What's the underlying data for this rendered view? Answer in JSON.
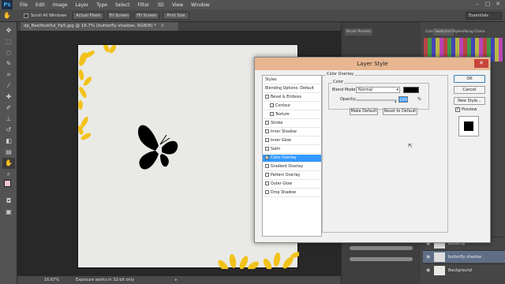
{
  "app": {
    "logo": "Ps"
  },
  "menu": [
    "File",
    "Edit",
    "Image",
    "Layer",
    "Type",
    "Select",
    "Filter",
    "3D",
    "View",
    "Window"
  ],
  "window_controls": {
    "minimize": "–",
    "maximize": "□",
    "close": "✕"
  },
  "options_bar": {
    "scroll_all_label": "Scroll All Windows",
    "actual_pixels": "Actual Pixels",
    "fit_screen": "Fit Screen",
    "fill_screen": "Fill Screen",
    "print_size": "Print Size",
    "workspace": "Essentials"
  },
  "document": {
    "tab_title": "dp_BeeYoutiful_Pp5.jpg @ 16.7% (butterfly shadow, RGB/8) *"
  },
  "status": {
    "zoom": "16.67%",
    "message": "Exposure works in 32-bit only"
  },
  "panels": {
    "brush_presets": "Brush Presets",
    "tabs": [
      "Color",
      "Swatches",
      "Styles",
      "Parag",
      "Chara"
    ]
  },
  "layers": [
    {
      "name": "butterfly",
      "italic": false
    },
    {
      "name": "butterfly shadow",
      "italic": false,
      "selected": true
    },
    {
      "name": "Background",
      "italic": true
    }
  ],
  "dialog": {
    "title": "Layer Style",
    "close": "✕",
    "styles_header": "Styles",
    "blending_options": "Blending Options: Default",
    "effects": [
      {
        "label": "Bevel & Emboss",
        "checked": false,
        "indent": false
      },
      {
        "label": "Contour",
        "checked": false,
        "indent": true
      },
      {
        "label": "Texture",
        "checked": false,
        "indent": true
      },
      {
        "label": "Stroke",
        "checked": false,
        "indent": false
      },
      {
        "label": "Inner Shadow",
        "checked": false,
        "indent": false
      },
      {
        "label": "Inner Glow",
        "checked": false,
        "indent": false
      },
      {
        "label": "Satin",
        "checked": false,
        "indent": false
      },
      {
        "label": "Color Overlay",
        "checked": true,
        "indent": false,
        "selected": true
      },
      {
        "label": "Gradient Overlay",
        "checked": false,
        "indent": false
      },
      {
        "label": "Pattern Overlay",
        "checked": false,
        "indent": false
      },
      {
        "label": "Outer Glow",
        "checked": false,
        "indent": false
      },
      {
        "label": "Drop Shadow",
        "checked": false,
        "indent": false
      }
    ],
    "color_overlay": {
      "group_title": "Color Overlay",
      "sub_title": "Color",
      "blend_mode_label": "Blend Mode:",
      "blend_mode_value": "Normal",
      "opacity_label": "Opacity:",
      "opacity_value": "100",
      "opacity_unit": "%",
      "opacity_level": 1.0,
      "swatch_color": "#000000",
      "make_default": "Make Default",
      "reset_default": "Reset to Default"
    },
    "ok": "OK",
    "cancel": "Cancel",
    "new_style": "New Style...",
    "preview_label": "Preview",
    "preview_checked": true
  },
  "colors": {
    "flower_yellow": "#f2c21b",
    "selection_blue": "#3399ff",
    "dialog_title_bar": "#e8b690"
  }
}
